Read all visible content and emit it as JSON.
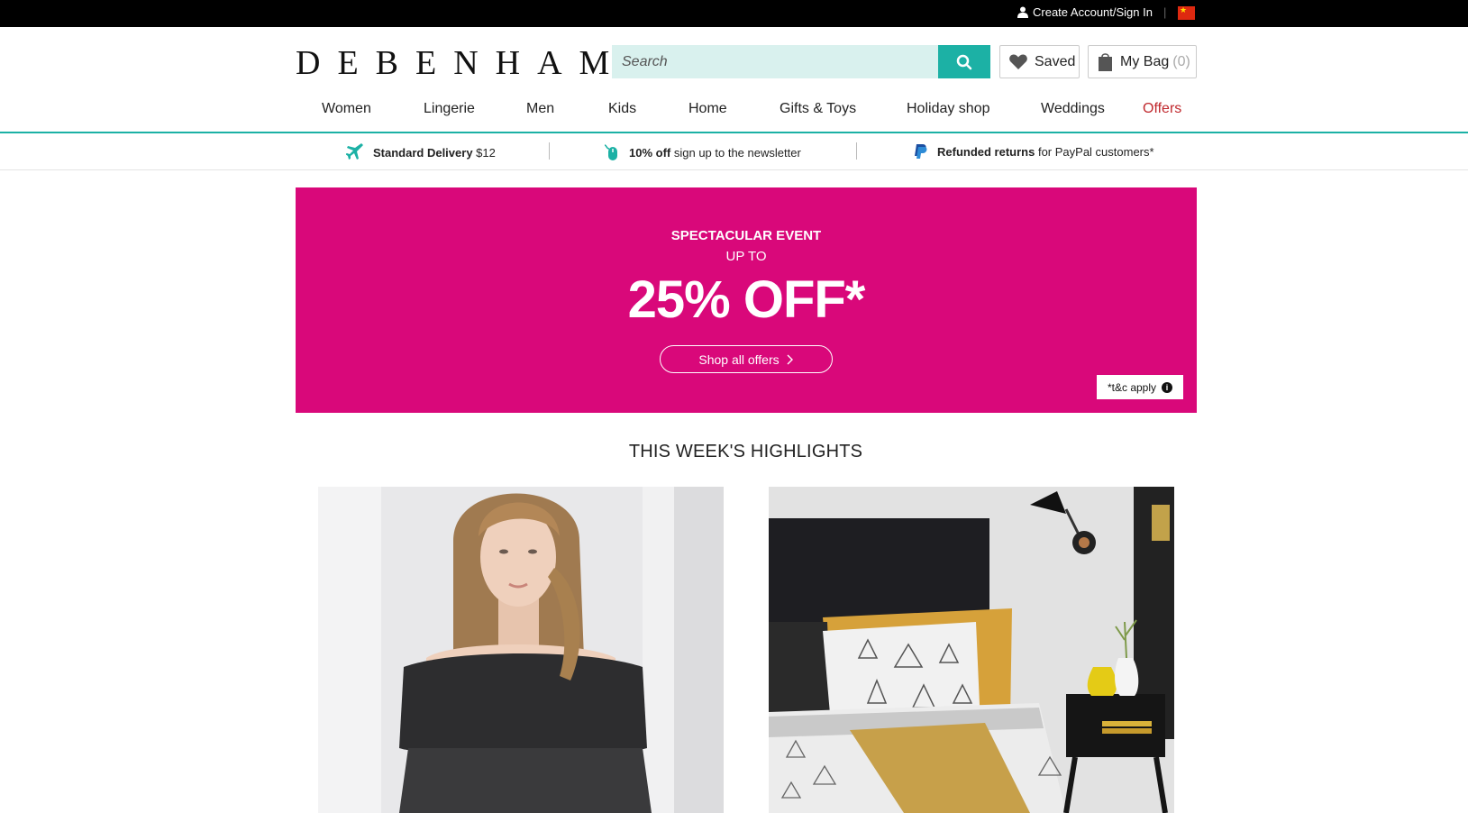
{
  "topbar": {
    "account_label": "Create Account/Sign In",
    "separator": "|",
    "flag_icon": "china-flag-icon"
  },
  "header": {
    "logo": "DEBENHAMS",
    "search_placeholder": "Search",
    "saved_label": "Saved",
    "bag_label": "My Bag",
    "bag_count": "(0)",
    "accent_color": "#1cb1a5"
  },
  "nav": {
    "items": [
      {
        "label": "Women"
      },
      {
        "label": "Lingerie"
      },
      {
        "label": "Men"
      },
      {
        "label": "Kids"
      },
      {
        "label": "Home"
      },
      {
        "label": "Gifts & Toys"
      },
      {
        "label": "Holiday shop"
      },
      {
        "label": "Weddings"
      },
      {
        "label": "Offers"
      }
    ]
  },
  "strip": {
    "delivery_bold": "Standard Delivery",
    "delivery_rest": "$12",
    "newsletter_bold": "10% off",
    "newsletter_rest": "sign up to the newsletter",
    "returns_bold": "Refunded returns",
    "returns_rest": "for PayPal customers*"
  },
  "banner": {
    "line1": "SPECTACULAR EVENT",
    "line2": "UP TO",
    "headline": "25% OFF*",
    "cta": "Shop all offers",
    "tc": "*t&c apply",
    "bg_color": "#d9087a"
  },
  "highlights": {
    "title": "THIS WEEK'S HIGHLIGHTS"
  }
}
